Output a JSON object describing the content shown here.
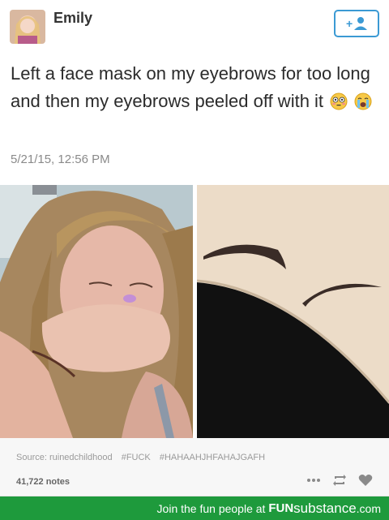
{
  "tweet": {
    "author": "Emily",
    "text": "Left a face mask on my eyebrows for too long and then my eyebrows peeled off with it",
    "emojis": [
      "flushed-face-emoji",
      "crying-face-emoji"
    ],
    "timestamp": "5/21/15, 12:56 PM",
    "follow_icon": "add-user-icon",
    "accent_color": "#3b9ad4"
  },
  "post_meta": {
    "source": "Source: ruinedchildhood",
    "tags": [
      "#FUCK",
      "#HAHAAHJHFAHAJGAFH"
    ],
    "notes": "41,722 notes",
    "actions": [
      "more-icon",
      "reblog-icon",
      "heart-icon"
    ]
  },
  "footer": {
    "prefix": "Join the fun people at",
    "brand_bold": "FUN",
    "brand_light": "substance",
    "brand_suffix": ".com",
    "color": "#1e9a3c"
  }
}
